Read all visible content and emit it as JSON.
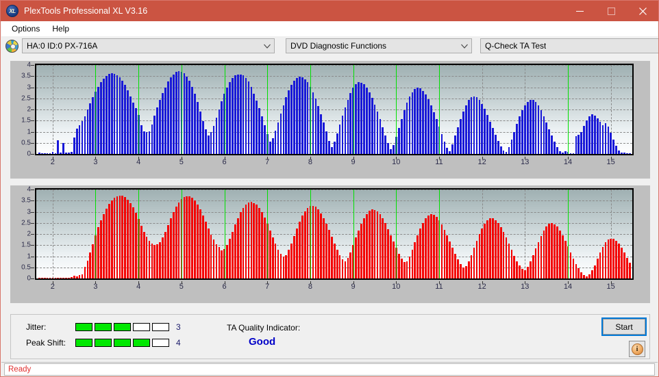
{
  "window": {
    "title": "PlexTools Professional XL V3.16",
    "app_icon": "XL",
    "icon_name": "plextools-xl-icon",
    "titlebar_color": "#cb5442",
    "minimize_label": "Minimize",
    "maximize_label": "Maximize",
    "close_label": "Close"
  },
  "menu": {
    "items": [
      {
        "label": "Options"
      },
      {
        "label": "Help"
      }
    ]
  },
  "toolbar": {
    "drive_combo": {
      "value": "HA:0 ID:0  PX-716A",
      "icon": "disc-icon"
    },
    "function_combo": {
      "value": "DVD Diagnostic Functions"
    },
    "test_combo": {
      "value": "Q-Check TA Test"
    }
  },
  "bottom": {
    "jitter": {
      "label": "Jitter:",
      "value": "3",
      "filled": 3,
      "total": 5
    },
    "peak_shift": {
      "label": "Peak Shift:",
      "value": "4",
      "filled": 4,
      "total": 5
    },
    "ta_quality": {
      "label": "TA Quality Indicator:",
      "value": "Good",
      "color": "#0000c8"
    },
    "start_button": {
      "label": "Start"
    },
    "info_button": {
      "label": "i"
    }
  },
  "status": {
    "text": "Ready",
    "color": "#e03030"
  },
  "colors": {
    "bar_blue": "#1818d8",
    "bar_red": "#f40000",
    "marker_green": "#00e000",
    "titlebar": "#cb5442",
    "meter_green": "#00e800"
  },
  "chart_data": [
    {
      "type": "bar",
      "name": "ta-chart-top",
      "series_color": "#1818d8",
      "title": "",
      "xlabel": "",
      "ylabel": "",
      "xlim": [
        1.62,
        15.5
      ],
      "ylim": [
        0,
        4
      ],
      "yticks": [
        0,
        0.5,
        1,
        1.5,
        2,
        2.5,
        3,
        3.5,
        4
      ],
      "xticks": [
        2,
        3,
        4,
        5,
        6,
        7,
        8,
        9,
        10,
        11,
        12,
        13,
        14,
        15
      ],
      "grid": true,
      "markers_x": [
        3,
        4,
        5,
        6,
        7,
        8,
        9,
        10,
        11,
        14
      ],
      "marker_color": "#00e000",
      "bar_step": 0.0625,
      "x_start": 1.69,
      "values": [
        0.06,
        0.02,
        0.02,
        0.04,
        0.02,
        0.08,
        0.03,
        0.63,
        0.05,
        0.49,
        0.05,
        0.06,
        0.08,
        0.73,
        1.13,
        1.3,
        1.47,
        1.7,
        2.0,
        2.28,
        2.55,
        2.8,
        3.02,
        3.22,
        3.4,
        3.52,
        3.6,
        3.62,
        3.6,
        3.55,
        3.45,
        3.3,
        3.1,
        2.86,
        2.6,
        2.3,
        2.05,
        1.74,
        1.28,
        1.03,
        0.97,
        1.03,
        1.33,
        1.72,
        2.08,
        2.42,
        2.73,
        3.0,
        3.25,
        3.44,
        3.58,
        3.68,
        3.72,
        3.7,
        3.62,
        3.48,
        3.28,
        3.02,
        2.7,
        2.33,
        1.9,
        1.48,
        1.12,
        0.82,
        0.97,
        1.25,
        1.62,
        2.0,
        2.38,
        2.7,
        3.0,
        3.24,
        3.42,
        3.53,
        3.57,
        3.58,
        3.54,
        3.42,
        3.25,
        3.02,
        2.72,
        2.4,
        2.05,
        1.7,
        1.28,
        0.88,
        0.56,
        0.72,
        1.04,
        1.42,
        1.82,
        2.2,
        2.55,
        2.85,
        3.1,
        3.3,
        3.42,
        3.47,
        3.44,
        3.36,
        3.22,
        3.02,
        2.78,
        2.48,
        2.15,
        1.8,
        1.42,
        1.02,
        0.6,
        0.3,
        0.55,
        0.92,
        1.32,
        1.72,
        2.1,
        2.44,
        2.74,
        2.98,
        3.14,
        3.22,
        3.21,
        3.13,
        2.98,
        2.78,
        2.52,
        2.22,
        1.9,
        1.56,
        1.2,
        0.84,
        0.5,
        0.22,
        0.4,
        0.78,
        1.18,
        1.58,
        1.96,
        2.3,
        2.58,
        2.78,
        2.92,
        2.97,
        2.94,
        2.84,
        2.68,
        2.46,
        2.18,
        1.88,
        1.56,
        1.22,
        0.88,
        0.55,
        0.28,
        0.12,
        0.44,
        0.82,
        1.2,
        1.58,
        1.92,
        2.2,
        2.42,
        2.56,
        2.6,
        2.56,
        2.44,
        2.26,
        2.03,
        1.76,
        1.46,
        1.16,
        0.86,
        0.58,
        0.34,
        0.14,
        0.08,
        0.3,
        0.64,
        1.0,
        1.36,
        1.7,
        1.98,
        2.2,
        2.35,
        2.43,
        2.42,
        2.34,
        2.18,
        1.96,
        1.7,
        1.42,
        1.12,
        0.82,
        0.54,
        0.3,
        0.12,
        0.05,
        0.12,
        0.08,
        0.04,
        0.04,
        0.8,
        0.86,
        0.98,
        1.26,
        1.52,
        1.7,
        1.78,
        1.72,
        1.6,
        1.44,
        1.28,
        1.4,
        1.22,
        0.96,
        0.66,
        0.38,
        0.16,
        0.06,
        0.05,
        0.04,
        0.03,
        0.04,
        0.03,
        0.03,
        0.04,
        0.03,
        0.03,
        0.03,
        0.03,
        0.03,
        0.03,
        0.03,
        0.03,
        0.03,
        0.03,
        0.03,
        0.04,
        0.03,
        0.03,
        0.03,
        0.03,
        0.03,
        0.03,
        0.03,
        0.03,
        0.03,
        0.03,
        0.03,
        0.05,
        0.03,
        0.03,
        0.03,
        0.03,
        0.03,
        0.03,
        0.04,
        0.05,
        0.03,
        0.03,
        0.03,
        0.03,
        0.03,
        0.04,
        0.05,
        0.06,
        0.05,
        0.08,
        0.04,
        0.1,
        0.12,
        0.56,
        1.02,
        1.54,
        1.9,
        2.1,
        2.2,
        2.22,
        2.22,
        2.2,
        2.16,
        2.06,
        1.9,
        1.3,
        0.86,
        0.52,
        0.06,
        0.05,
        0.04,
        0.03,
        0.03,
        0.03,
        0.03,
        0.03,
        0.03,
        0.03,
        0.03,
        0.03,
        0.03,
        0.03,
        0.03,
        0.03,
        0.03,
        0.03,
        0.03,
        0.03,
        0.03,
        0.03,
        0.03,
        0.03,
        0.03,
        0.03,
        0.03,
        0.03,
        0.03,
        0.03,
        0.03,
        0.03,
        0.03,
        0.03
      ]
    },
    {
      "type": "bar",
      "name": "ta-chart-bottom",
      "series_color": "#f40000",
      "title": "",
      "xlabel": "",
      "ylabel": "",
      "xlim": [
        1.62,
        15.5
      ],
      "ylim": [
        0,
        4
      ],
      "yticks": [
        0,
        0.5,
        1,
        1.5,
        2,
        2.5,
        3,
        3.5,
        4
      ],
      "xticks": [
        2,
        3,
        4,
        5,
        6,
        7,
        8,
        9,
        10,
        11,
        12,
        13,
        14,
        15
      ],
      "grid": true,
      "markers_x": [
        3,
        4,
        5,
        6,
        7,
        8,
        9,
        10,
        11,
        14
      ],
      "marker_color": "#00e000",
      "bar_step": 0.0625,
      "x_start": 1.69,
      "values": [
        0.02,
        0.02,
        0.02,
        0.02,
        0.02,
        0.02,
        0.02,
        0.02,
        0.02,
        0.02,
        0.02,
        0.02,
        0.07,
        0.12,
        0.08,
        0.14,
        0.18,
        0.52,
        0.8,
        1.18,
        1.55,
        1.93,
        2.3,
        2.62,
        2.9,
        3.14,
        3.34,
        3.5,
        3.62,
        3.7,
        3.73,
        3.72,
        3.66,
        3.55,
        3.4,
        3.2,
        2.96,
        2.68,
        2.38,
        2.1,
        1.88,
        1.7,
        1.58,
        1.52,
        1.54,
        1.64,
        1.84,
        2.1,
        2.4,
        2.7,
        2.98,
        3.22,
        3.42,
        3.56,
        3.65,
        3.69,
        3.68,
        3.62,
        3.5,
        3.32,
        3.1,
        2.84,
        2.56,
        2.26,
        1.98,
        1.74,
        1.55,
        1.42,
        1.26,
        1.32,
        1.5,
        1.78,
        2.1,
        2.42,
        2.72,
        2.98,
        3.18,
        3.33,
        3.42,
        3.44,
        3.4,
        3.32,
        3.18,
        2.98,
        2.74,
        2.46,
        2.16,
        1.85,
        1.56,
        1.3,
        1.1,
        0.98,
        1.06,
        1.28,
        1.58,
        1.92,
        2.26,
        2.56,
        2.82,
        3.03,
        3.18,
        3.26,
        3.27,
        3.22,
        3.1,
        2.93,
        2.72,
        2.46,
        2.18,
        1.88,
        1.58,
        1.3,
        1.05,
        0.86,
        0.78,
        0.92,
        1.18,
        1.5,
        1.84,
        2.16,
        2.45,
        2.7,
        2.9,
        3.04,
        3.1,
        3.09,
        3.01,
        2.88,
        2.7,
        2.48,
        2.22,
        1.94,
        1.66,
        1.38,
        1.12,
        0.9,
        0.74,
        0.78,
        1.0,
        1.3,
        1.62,
        1.94,
        2.24,
        2.5,
        2.7,
        2.83,
        2.89,
        2.87,
        2.78,
        2.63,
        2.44,
        2.2,
        1.94,
        1.66,
        1.38,
        1.1,
        0.85,
        0.64,
        0.5,
        0.56,
        0.78,
        1.06,
        1.38,
        1.7,
        2.0,
        2.26,
        2.47,
        2.62,
        2.7,
        2.7,
        2.63,
        2.5,
        2.32,
        2.1,
        1.85,
        1.58,
        1.3,
        1.03,
        0.78,
        0.57,
        0.42,
        0.38,
        0.52,
        0.76,
        1.04,
        1.34,
        1.64,
        1.92,
        2.16,
        2.34,
        2.45,
        2.48,
        2.44,
        2.33,
        2.16,
        1.95,
        1.7,
        1.44,
        1.17,
        0.9,
        0.66,
        0.45,
        0.28,
        0.16,
        0.1,
        0.18,
        0.36,
        0.6,
        0.88,
        1.16,
        1.42,
        1.62,
        1.75,
        1.8,
        1.78,
        1.7,
        1.56,
        1.38,
        1.16,
        0.93,
        0.7,
        0.48,
        0.3,
        0.17,
        0.08,
        0.05,
        0.04,
        0.04,
        0.04,
        0.04,
        0.05,
        0.06,
        0.05,
        0.06,
        0.09,
        0.1,
        0.12,
        0.16,
        0.26,
        0.46,
        0.7,
        0.95,
        1.16,
        1.3,
        1.36,
        1.33,
        1.23,
        1.1,
        0.97,
        0.86,
        1.02,
        0.92,
        0.72,
        0.52,
        0.34,
        0.2,
        0.11,
        0.06,
        0.07,
        0.12,
        0.07,
        0.04,
        0.04,
        0.04,
        0.04,
        0.04,
        0.04,
        0.04,
        0.04,
        0.04,
        0.04,
        0.04,
        0.04,
        0.04,
        0.04,
        0.04,
        0.04,
        0.04,
        0.04,
        0.04,
        0.04,
        0.04,
        0.04,
        0.04,
        0.04,
        0.04,
        0.04,
        0.04,
        0.04,
        0.04,
        0.04,
        0.04,
        0.04,
        0.04,
        0.04,
        0.05,
        0.04,
        0.04,
        0.04,
        0.04,
        0.04,
        0.04,
        1.22,
        1.1,
        0.92,
        1.12,
        1.35,
        1.02,
        0.88,
        0.92,
        0.76,
        0.5,
        0.28,
        0.16,
        0.08,
        0.04,
        0.04,
        0.04,
        0.04,
        0.04,
        0.04,
        0.04,
        0.04,
        0.04,
        0.04,
        0.04,
        0.04,
        0.04,
        0.04,
        0.04,
        0.04,
        0.04,
        0.04,
        0.04,
        0.04,
        0.04,
        0.04,
        0.04,
        0.04,
        0.04,
        0.04,
        0.04,
        0.04,
        0.04,
        0.04,
        0.04,
        0.04,
        0.04,
        0.04
      ]
    }
  ]
}
